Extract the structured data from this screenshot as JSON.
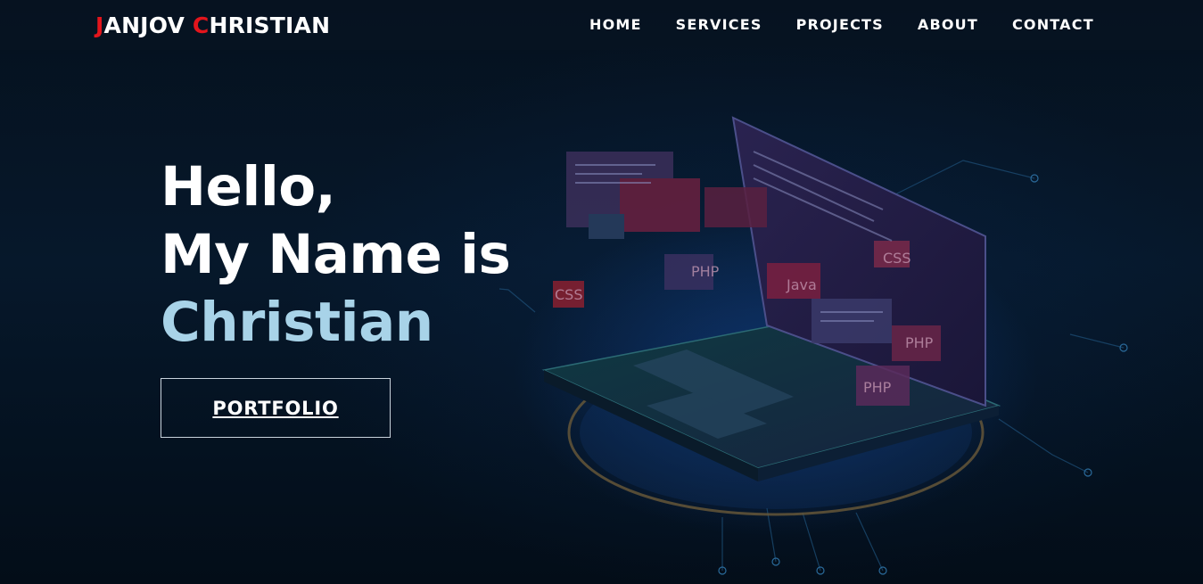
{
  "brand": {
    "first_initial": "J",
    "first_rest": "ANJOV ",
    "last_initial": "C",
    "last_rest": "HRISTIAN",
    "accent_color": "#e3151c"
  },
  "nav": {
    "items": [
      {
        "label": "HOME"
      },
      {
        "label": "SERVICES"
      },
      {
        "label": "PROJECTS"
      },
      {
        "label": "ABOUT"
      },
      {
        "label": "CONTACT"
      }
    ]
  },
  "hero": {
    "line1": "Hello,",
    "line2": "My Name is",
    "line3": "Christian",
    "name_color": "#a8d3e8",
    "button_label": "PORTFOLIO"
  },
  "illustration": {
    "icon": "laptop-code-illustration",
    "panel_labels": [
      "CSS",
      "PHP",
      "Java",
      "PHP",
      "PHP",
      "CSS"
    ]
  }
}
